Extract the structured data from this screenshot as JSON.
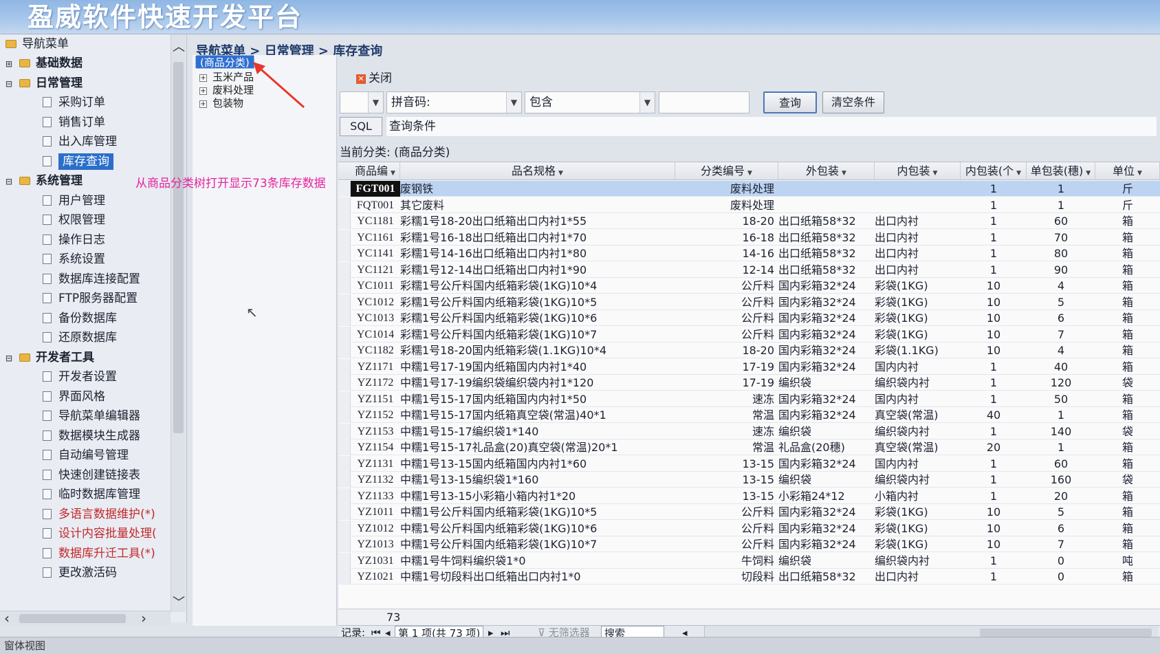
{
  "app_title": "盈威软件快速开发平台",
  "nav": {
    "root_label": "导航菜单",
    "items": [
      {
        "label": "基础数据",
        "type": "group",
        "expander": "⊞"
      },
      {
        "label": "日常管理",
        "type": "group",
        "expander": "⊟"
      },
      {
        "label": "采购订单",
        "type": "leaf"
      },
      {
        "label": "销售订单",
        "type": "leaf"
      },
      {
        "label": "出入库管理",
        "type": "leaf"
      },
      {
        "label": "库存查询",
        "type": "leaf",
        "selected": true
      },
      {
        "label": "系统管理",
        "type": "group",
        "expander": "⊟"
      },
      {
        "label": "用户管理",
        "type": "leaf"
      },
      {
        "label": "权限管理",
        "type": "leaf"
      },
      {
        "label": "操作日志",
        "type": "leaf"
      },
      {
        "label": "系统设置",
        "type": "leaf"
      },
      {
        "label": "数据库连接配置",
        "type": "leaf"
      },
      {
        "label": "FTP服务器配置",
        "type": "leaf"
      },
      {
        "label": "备份数据库",
        "type": "leaf"
      },
      {
        "label": "还原数据库",
        "type": "leaf"
      },
      {
        "label": "开发者工具",
        "type": "group",
        "expander": "⊟"
      },
      {
        "label": "开发者设置",
        "type": "leaf"
      },
      {
        "label": "界面风格",
        "type": "leaf"
      },
      {
        "label": "导航菜单编辑器",
        "type": "leaf"
      },
      {
        "label": "数据模块生成器",
        "type": "leaf"
      },
      {
        "label": "自动编号管理",
        "type": "leaf"
      },
      {
        "label": "快速创建链接表",
        "type": "leaf"
      },
      {
        "label": "临时数据库管理",
        "type": "leaf"
      },
      {
        "label": "多语言数据维护(*)",
        "type": "leaf",
        "red": true
      },
      {
        "label": "设计内容批量处理(",
        "type": "leaf",
        "red": true
      },
      {
        "label": "数据库升迁工具(*)",
        "type": "leaf",
        "red": true
      },
      {
        "label": "更改激活码",
        "type": "leaf"
      }
    ]
  },
  "breadcrumb": "导航菜单 > 日常管理 > 库存查询",
  "tree": {
    "root": "(商品分类)",
    "nodes": [
      "玉米产品",
      "废料处理",
      "包装物"
    ]
  },
  "annotation_text": "从商品分类树打开显示73条库存数据",
  "toolbar": {
    "close_label": "关闭",
    "field_label": "拼音码:",
    "operator_label": "包含",
    "query_value": "",
    "query_button": "查询",
    "clear_button": "清空条件",
    "sql_label": "SQL",
    "condition_label": "查询条件"
  },
  "current_category": "当前分类: (商品分类)",
  "grid": {
    "columns": [
      "商品编",
      "品名规格",
      "分类编号",
      "外包装",
      "内包装",
      "内包装(个",
      "单包装(穗)",
      "单位"
    ],
    "rows": [
      [
        "FGT001",
        "废钢铁",
        "废料处理",
        "",
        "",
        "1",
        "1",
        "斤"
      ],
      [
        "FQT001",
        "其它废料",
        "废料处理",
        "",
        "",
        "1",
        "1",
        "斤"
      ],
      [
        "YC1181",
        "彩糯1号18-20出口纸箱出口内衬1*55",
        "18-20",
        "出口纸箱58*32",
        "出口内衬",
        "1",
        "60",
        "箱"
      ],
      [
        "YC1161",
        "彩糯1号16-18出口纸箱出口内衬1*70",
        "16-18",
        "出口纸箱58*32",
        "出口内衬",
        "1",
        "70",
        "箱"
      ],
      [
        "YC1141",
        "彩糯1号14-16出口纸箱出口内衬1*80",
        "14-16",
        "出口纸箱58*32",
        "出口内衬",
        "1",
        "80",
        "箱"
      ],
      [
        "YC1121",
        "彩糯1号12-14出口纸箱出口内衬1*90",
        "12-14",
        "出口纸箱58*32",
        "出口内衬",
        "1",
        "90",
        "箱"
      ],
      [
        "YC1011",
        "彩糯1号公斤料国内纸箱彩袋(1KG)10*4",
        "公斤料",
        "国内彩箱32*24",
        "彩袋(1KG)",
        "10",
        "4",
        "箱"
      ],
      [
        "YC1012",
        "彩糯1号公斤料国内纸箱彩袋(1KG)10*5",
        "公斤料",
        "国内彩箱32*24",
        "彩袋(1KG)",
        "10",
        "5",
        "箱"
      ],
      [
        "YC1013",
        "彩糯1号公斤料国内纸箱彩袋(1KG)10*6",
        "公斤料",
        "国内彩箱32*24",
        "彩袋(1KG)",
        "10",
        "6",
        "箱"
      ],
      [
        "YC1014",
        "彩糯1号公斤料国内纸箱彩袋(1KG)10*7",
        "公斤料",
        "国内彩箱32*24",
        "彩袋(1KG)",
        "10",
        "7",
        "箱"
      ],
      [
        "YC1182",
        "彩糯1号18-20国内纸箱彩袋(1.1KG)10*4",
        "18-20",
        "国内彩箱32*24",
        "彩袋(1.1KG)",
        "10",
        "4",
        "箱"
      ],
      [
        "YZ1171",
        "中糯1号17-19国内纸箱国内内衬1*40",
        "17-19",
        "国内彩箱32*24",
        "国内内衬",
        "1",
        "40",
        "箱"
      ],
      [
        "YZ1172",
        "中糯1号17-19编织袋编织袋内衬1*120",
        "17-19",
        "编织袋",
        "编织袋内衬",
        "1",
        "120",
        "袋"
      ],
      [
        "YZ1151",
        "中糯1号15-17国内纸箱国内内衬1*50",
        "速冻",
        "国内彩箱32*24",
        "国内内衬",
        "1",
        "50",
        "箱"
      ],
      [
        "YZ1152",
        "中糯1号15-17国内纸箱真空袋(常温)40*1",
        "常温",
        "国内彩箱32*24",
        "真空袋(常温)",
        "40",
        "1",
        "箱"
      ],
      [
        "YZ1153",
        "中糯1号15-17编织袋1*140",
        "速冻",
        "编织袋",
        "编织袋内衬",
        "1",
        "140",
        "袋"
      ],
      [
        "YZ1154",
        "中糯1号15-17礼品盒(20)真空袋(常温)20*1",
        "常温",
        "礼品盒(20穗)",
        "真空袋(常温)",
        "20",
        "1",
        "箱"
      ],
      [
        "YZ1131",
        "中糯1号13-15国内纸箱国内内衬1*60",
        "13-15",
        "国内彩箱32*24",
        "国内内衬",
        "1",
        "60",
        "箱"
      ],
      [
        "YZ1132",
        "中糯1号13-15编织袋1*160",
        "13-15",
        "编织袋",
        "编织袋内衬",
        "1",
        "160",
        "袋"
      ],
      [
        "YZ1133",
        "中糯1号13-15小彩箱小箱内衬1*20",
        "13-15",
        "小彩箱24*12",
        "小箱内衬",
        "1",
        "20",
        "箱"
      ],
      [
        "YZ1011",
        "中糯1号公斤料国内纸箱彩袋(1KG)10*5",
        "公斤料",
        "国内彩箱32*24",
        "彩袋(1KG)",
        "10",
        "5",
        "箱"
      ],
      [
        "YZ1012",
        "中糯1号公斤料国内纸箱彩袋(1KG)10*6",
        "公斤料",
        "国内彩箱32*24",
        "彩袋(1KG)",
        "10",
        "6",
        "箱"
      ],
      [
        "YZ1013",
        "中糯1号公斤料国内纸箱彩袋(1KG)10*7",
        "公斤料",
        "国内彩箱32*24",
        "彩袋(1KG)",
        "10",
        "7",
        "箱"
      ],
      [
        "YZ1031",
        "中糯1号牛饲料编织袋1*0",
        "牛饲料",
        "编织袋",
        "编织袋内衬",
        "1",
        "0",
        "吨"
      ],
      [
        "YZ1021",
        "中糯1号切段料出口纸箱出口内衬1*0",
        "切段料",
        "出口纸箱58*32",
        "出口内衬",
        "1",
        "0",
        "箱"
      ]
    ],
    "record_count": "73"
  },
  "navigator": {
    "record_label": "记录:",
    "page_info": "第 1 项(共 73 项)",
    "no_filter": "无筛选器",
    "search_label": "搜索"
  },
  "status_bar": "窗体视图",
  "colors": {
    "title_banner": "#8fb6e3",
    "selection": "#2b6fc9",
    "annotation": "#e3259f",
    "arrow": "#e8372c"
  }
}
